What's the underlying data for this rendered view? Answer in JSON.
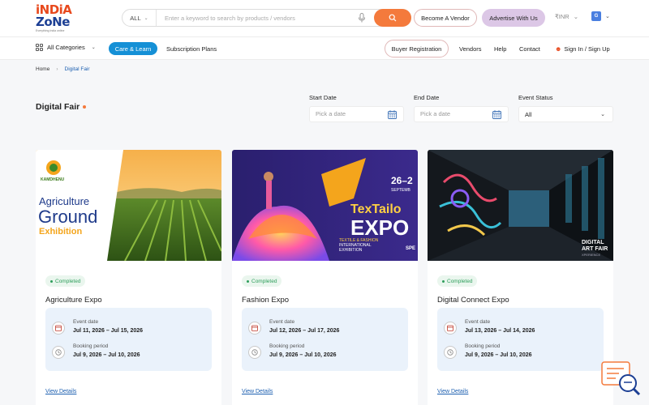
{
  "header": {
    "logo_line1": "iNDiA",
    "logo_line2": "ZoNe",
    "logo_tagline": "Everything India online",
    "search_category": "ALL",
    "search_placeholder": "Enter a keyword to search by products / vendors",
    "become_vendor_label": "Become A Vendor",
    "advertise_label": "Advertise With Us",
    "currency": "₹INR",
    "language_icon": "translate-icon"
  },
  "nav": {
    "all_categories_label": "All Categories",
    "care_learn_label": "Care & Learn",
    "subscription_label": "Subscription Plans",
    "buyer_registration_label": "Buyer Registration",
    "links": [
      "Vendors",
      "Help",
      "Contact"
    ],
    "signin_label": "Sign In / Sign Up"
  },
  "breadcrumb": {
    "home": "Home",
    "separator": "›",
    "current": "Digital Fair"
  },
  "page": {
    "title": "Digital Fair",
    "filters": {
      "start_date_label": "Start Date",
      "start_date_placeholder": "Pick a date",
      "end_date_label": "End Date",
      "end_date_placeholder": "Pick a date",
      "event_status_label": "Event Status",
      "event_status_value": "All"
    }
  },
  "events": [
    {
      "title": "Agriculture Expo",
      "status": "Completed",
      "event_date_label": "Event date",
      "event_date": "Jul 11, 2026 – Jul 15, 2026",
      "booking_label": "Booking period",
      "booking_period": "Jul 9, 2026 – Jul 10, 2026",
      "view_label": "View Details",
      "image_text": {
        "brand": "KAMDHENU",
        "line1": "Agriculture",
        "line2": "Ground",
        "line3": "Exhibition"
      }
    },
    {
      "title": "Fashion Expo",
      "status": "Completed",
      "event_date_label": "Event date",
      "event_date": "Jul 12, 2026 – Jul 17, 2026",
      "booking_label": "Booking period",
      "booking_period": "Jul 9, 2026 – Jul 10, 2026",
      "view_label": "View Details",
      "image_text": {
        "date": "26–2",
        "month": "SEPTEMB",
        "line1": "TexTailo",
        "line2": "EXPO",
        "sub1": "TEXTILE & FASHION",
        "sub2": "INTERNATIONAL",
        "sub3": "EXHIBITION",
        "corner": "SPE"
      }
    },
    {
      "title": "Digital Connect Expo",
      "status": "Completed",
      "event_date_label": "Event date",
      "event_date": "Jul 13, 2026 – Jul 14, 2026",
      "booking_label": "Booking period",
      "booking_period": "Jul 9, 2026 – Jul 10, 2026",
      "view_label": "View Details",
      "image_text": {
        "line1": "DIGITAL",
        "line2": "ART FAIR",
        "line3": "XPERIENCE"
      }
    }
  ],
  "colors": {
    "accent_orange": "#f47a3c",
    "brand_blue": "#1c3f94",
    "care_blue": "#1590d6",
    "status_green": "#2e9e5b",
    "info_bg": "#eaf2fb"
  }
}
